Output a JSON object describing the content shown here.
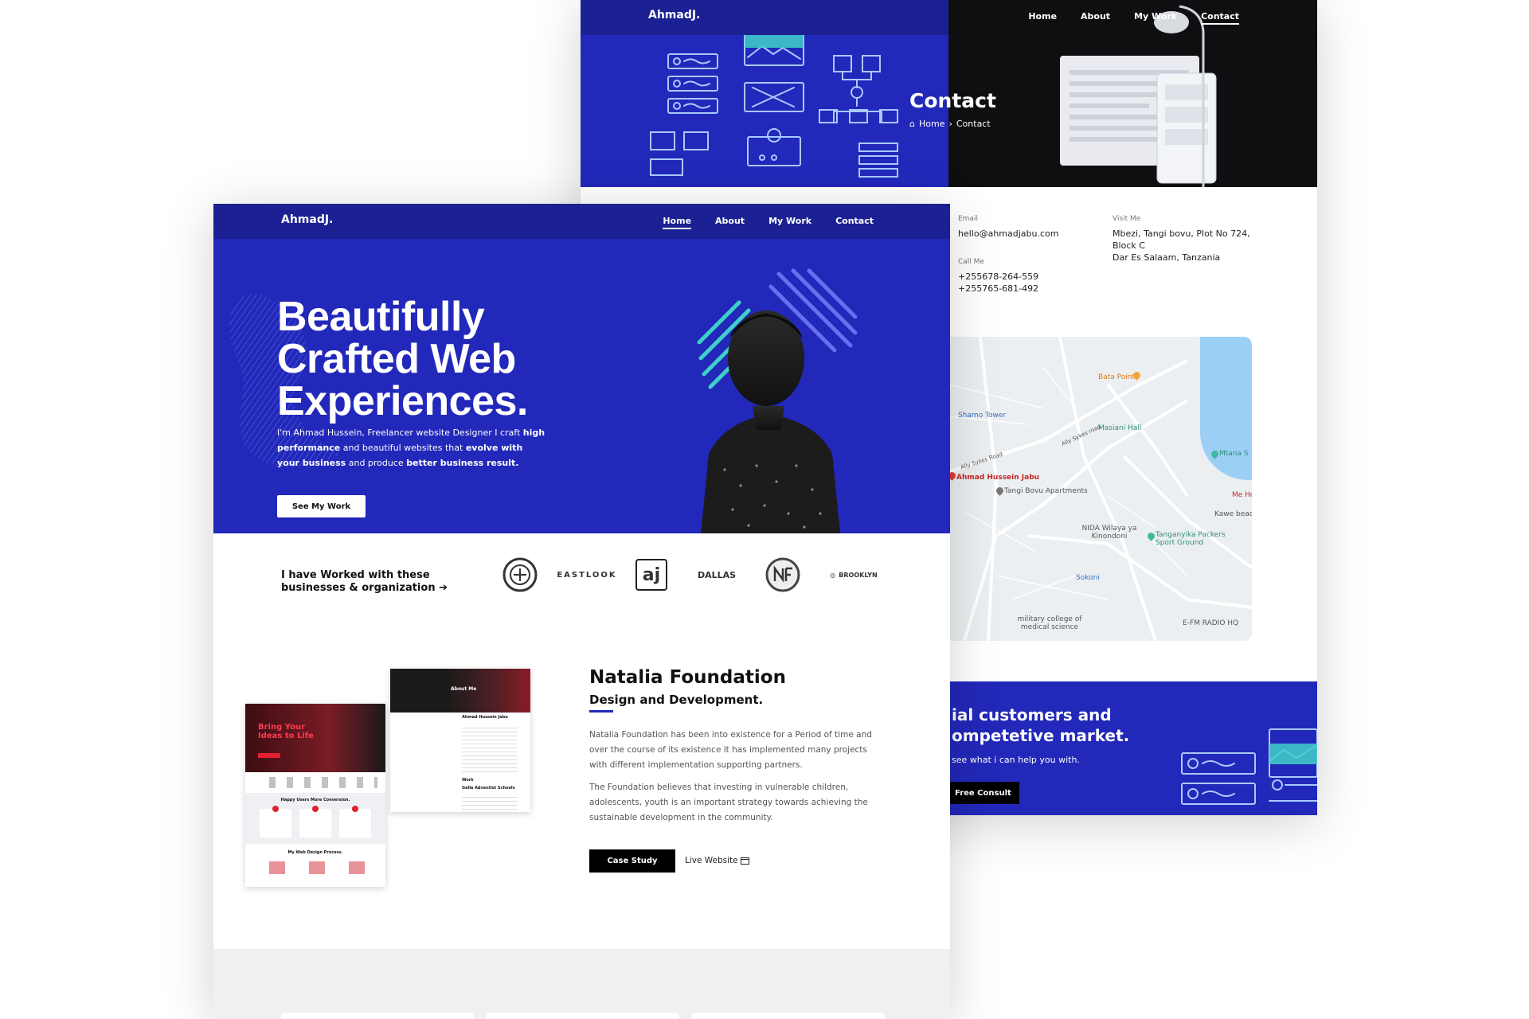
{
  "back_page": {
    "brand": "AhmadJ.",
    "nav": [
      "Home",
      "About",
      "My Work",
      "Contact"
    ],
    "active_nav": "Contact",
    "title": "Contact",
    "breadcrumb": {
      "home": "Home",
      "separator": "›",
      "current": "Contact"
    },
    "email": {
      "label": "Email",
      "value": "hello@ahmadjabu.com"
    },
    "visit": {
      "label": "Visit Me",
      "line1": "Mbezi, Tangi bovu, Plot No 724,",
      "line2": "Block C",
      "line3": "Dar Es Salaam, Tanzania"
    },
    "call": {
      "label": "Call Me",
      "phone1": "+255678-264-559",
      "phone2": "+255765-681-492"
    },
    "map": {
      "labels": [
        "Bata Point",
        "Shamo Tower",
        "Masiani Hall",
        "Mtana S",
        "Ahmad Hussein Jabu",
        "Tangi Bovu Apartments",
        "Me Ho",
        "Kawe beac",
        "NIDA Wilaya ya Kinondoni",
        "Tanganyika Packers Sport Ground",
        "Sokoni",
        "military college of medical science",
        "E-FM RADIO HQ"
      ],
      "roads": [
        "Ally Sykes road",
        "Ally Sykes Road"
      ]
    },
    "cta": {
      "line1": "ial customers and",
      "line2": "ompetetive market.",
      "subtitle": "see what i can help you with.",
      "button": "Free Consult"
    }
  },
  "front_page": {
    "brand": "AhmadJ.",
    "nav": [
      "Home",
      "About",
      "My Work",
      "Contact"
    ],
    "active_nav": "Home",
    "hero": {
      "title_line1": "Beautifully",
      "title_line2": "Crafted Web",
      "title_line3": "Experiences.",
      "desc_parts": [
        {
          "t": "I'm Ahmad Hussein, Freelancer website Designer I craft ",
          "b": false
        },
        {
          "t": "high performance",
          "b": true
        },
        {
          "t": " and beautiful websites that ",
          "b": false
        },
        {
          "t": "evolve with your business",
          "b": true
        },
        {
          "t": " and produce ",
          "b": false
        },
        {
          "t": "better business result.",
          "b": true
        }
      ],
      "button": "See My Work"
    },
    "clients": {
      "line1": "I have Worked with these",
      "line2": "businesses & organization",
      "arrow": "➔",
      "logos": [
        "aj",
        "EASTLOOK",
        "DALLAS",
        "BROOKLYN"
      ]
    },
    "project": {
      "title": "Natalia Foundation",
      "subtitle": "Design and Development.",
      "p1": "Natalia Foundation has been into existence for a Period of time and over the course of its existence it has implemented many projects with different implementation supporting partners.",
      "p2": "The Foundation believes that investing in vulnerable children, adolescents, youth is an important strategy towards achieving the sustainable development in the community.",
      "case_button": "Case Study",
      "live_link": "Live Website",
      "thumb": {
        "about_me": "About Me",
        "name": "Ahmad Hussein Jabu",
        "headline": "Bring Your Ideas to Life",
        "work": "Work",
        "school": "Gella Adventist Schools",
        "conversion": "Happy Users More Conversion.",
        "process": "My Web Design Process."
      }
    }
  },
  "colors": {
    "primary_blue": "#2228b9",
    "nav_blue": "#1b2193",
    "black": "#000000",
    "accent_teal": "#3fd0c9",
    "gray_bg": "#f0f0f2"
  }
}
